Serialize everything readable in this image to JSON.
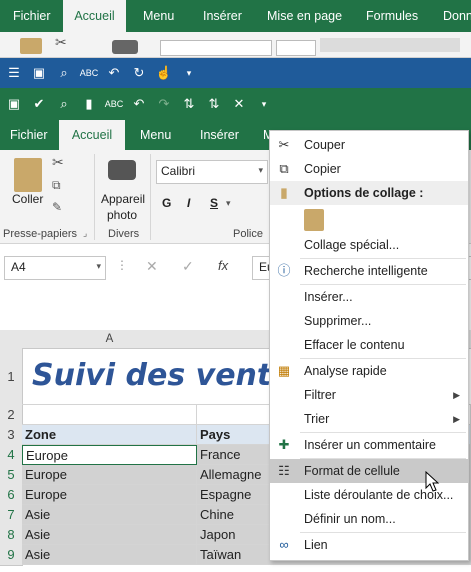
{
  "bg_ribbon": {
    "tabs": [
      "Fichier",
      "Accueil",
      "Menu",
      "Insérer",
      "Mise en page",
      "Formules",
      "Données"
    ],
    "active_tab": "Accueil"
  },
  "ribbon": {
    "tabs": [
      "Fichier",
      "Accueil",
      "Menu",
      "Insérer",
      "Mise en page"
    ],
    "active_tab": "Accueil",
    "paste_label": "Coller",
    "clipboard_group": "Presse-papiers",
    "camera_label_1": "Appareil",
    "camera_label_2": "photo",
    "divers_group": "Divers",
    "font_name": "Calibri",
    "bold": "G",
    "italic": "I",
    "underline": "S",
    "police_group": "Police"
  },
  "formula_bar": {
    "name_box": "A4",
    "fx": "fx",
    "content": "Eu"
  },
  "sheet": {
    "col_a": "A",
    "title": "Suivi des ventes",
    "rows": [
      "1",
      "2",
      "3",
      "4",
      "5",
      "6",
      "7",
      "8",
      "9"
    ],
    "header": {
      "zone": "Zone",
      "pays": "Pays"
    },
    "data": [
      {
        "zone": "Europe",
        "pays": "France"
      },
      {
        "zone": "Europe",
        "pays": "Allemagne"
      },
      {
        "zone": "Europe",
        "pays": "Espagne"
      },
      {
        "zone": "Asie",
        "pays": "Chine"
      },
      {
        "zone": "Asie",
        "pays": "Japon"
      },
      {
        "zone": "Asie",
        "pays": "Taïwan"
      }
    ]
  },
  "context_menu": {
    "cut": "Couper",
    "copy": "Copier",
    "paste_options": "Options de collage :",
    "paste_special": "Collage spécial...",
    "smart_lookup": "Recherche intelligente",
    "insert": "Insérer...",
    "delete": "Supprimer...",
    "clear": "Effacer le contenu",
    "quick_analysis": "Analyse rapide",
    "filter": "Filtrer",
    "sort": "Trier",
    "insert_comment": "Insérer un commentaire",
    "format_cells": "Format de cellule",
    "dropdown_list": "Liste déroulante de choix...",
    "define_name": "Définir un nom...",
    "link": "Lien"
  },
  "colors": {
    "brand": "#217346",
    "title_blue": "#2e5597"
  }
}
